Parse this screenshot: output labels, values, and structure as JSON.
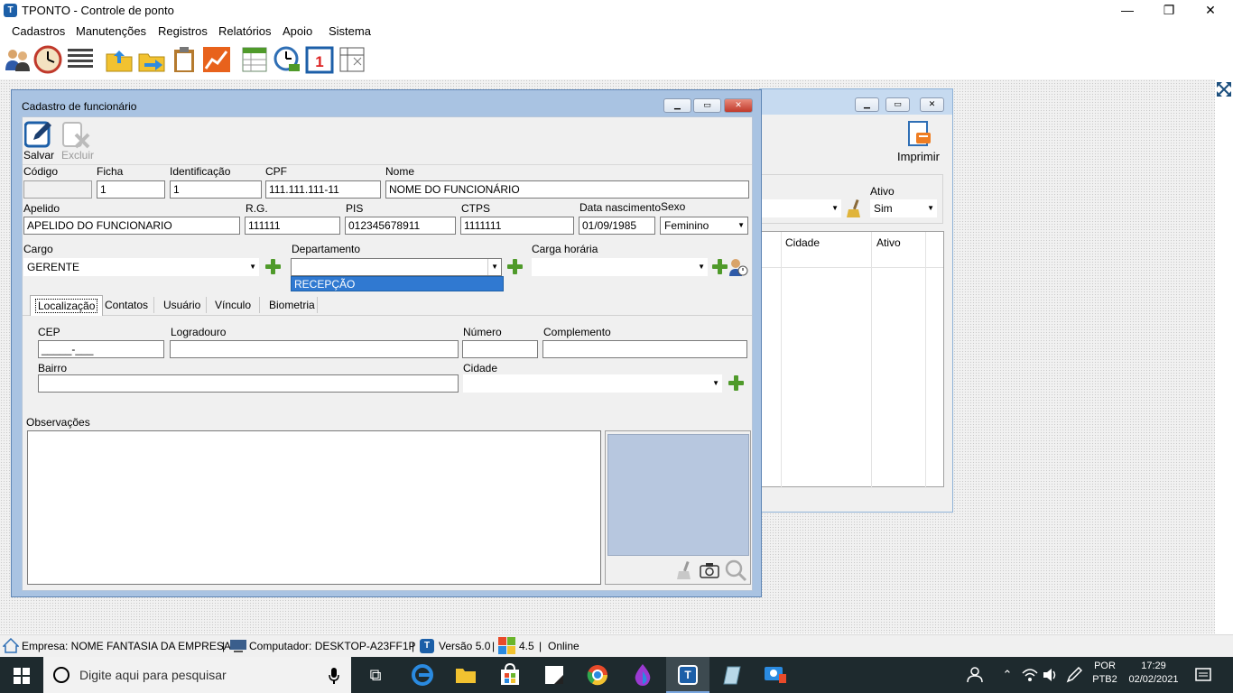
{
  "app": {
    "title": "TPONTO - Controle de ponto",
    "icon_letter": "T"
  },
  "window_controls": {
    "minimize": "—",
    "maximize": "❐",
    "close": "✕"
  },
  "menu": [
    "Cadastros",
    "Manutenções",
    "Registros",
    "Relatórios",
    "Apoio",
    "Sistema"
  ],
  "toolbar_icons": [
    "users-icon",
    "clock-icon",
    "list-icon",
    "folder-up-icon",
    "folder-export-icon",
    "clipboard-icon",
    "chart-icon",
    "spreadsheet-icon",
    "clock-check-icon",
    "calendar-one-icon",
    "grid-icon"
  ],
  "calendar_number": "1",
  "back_window": {
    "print_label": "Imprimir",
    "ativo_label": "Ativo",
    "ativo_value": "Sim",
    "columns": [
      "Cidade",
      "Ativo"
    ]
  },
  "form": {
    "title": "Cadastro de funcionário",
    "save_label": "Salvar",
    "delete_label": "Excluir",
    "codigo_label": "Código",
    "codigo_value": "",
    "ficha_label": "Ficha",
    "ficha_value": "1",
    "identificacao_label": "Identificação",
    "identificacao_value": "1",
    "cpf_label": "CPF",
    "cpf_value": "111.111.111-11",
    "nome_label": "Nome",
    "nome_value": "NOME DO FUNCIONÁRIO",
    "apelido_label": "Apelido",
    "apelido_value": "APELIDO DO FUNCIONARIO",
    "rg_label": "R.G.",
    "rg_value": "111111",
    "pis_label": "PIS",
    "pis_value": "012345678911",
    "ctps_label": "CTPS",
    "ctps_value": "1111111",
    "nascimento_label": "Data nascimento",
    "nascimento_value": "01/09/1985",
    "sexo_label": "Sexo",
    "sexo_value": "Feminino",
    "cargo_label": "Cargo",
    "cargo_value": "GERENTE",
    "departamento_label": "Departamento",
    "departamento_value": "",
    "departamento_option": "RECEPÇÃO",
    "carga_label": "Carga horária",
    "carga_value": "",
    "tabs": [
      "Localização",
      "Contatos",
      "Usuário",
      "Vínculo",
      "Biometria"
    ],
    "cep_label": "CEP",
    "cep_value": "_____-___",
    "logradouro_label": "Logradouro",
    "logradouro_value": "",
    "numero_label": "Número",
    "numero_value": "",
    "complemento_label": "Complemento",
    "complemento_value": "",
    "bairro_label": "Bairro",
    "bairro_value": "",
    "cidade_label": "Cidade",
    "cidade_value": "",
    "observacoes_label": "Observações",
    "observacoes_value": ""
  },
  "statusbar": {
    "empresa": "Empresa: NOME FANTASIA DA EMPRESA",
    "computador": "Computador: DESKTOP-A23FF1P",
    "versao": "Versão 5.0",
    "num": "4.5",
    "online": "Online",
    "sep": "|"
  },
  "taskbar": {
    "search_placeholder": "Digite aqui para pesquisar",
    "lang": "POR",
    "layout": "PTB2",
    "time": "17:29",
    "date": "02/02/2021"
  },
  "colors": {
    "accent": "#1c5fa8",
    "selection": "#3079d1",
    "photo_bg": "#b7c7df",
    "plus": "#4f9a2a"
  }
}
